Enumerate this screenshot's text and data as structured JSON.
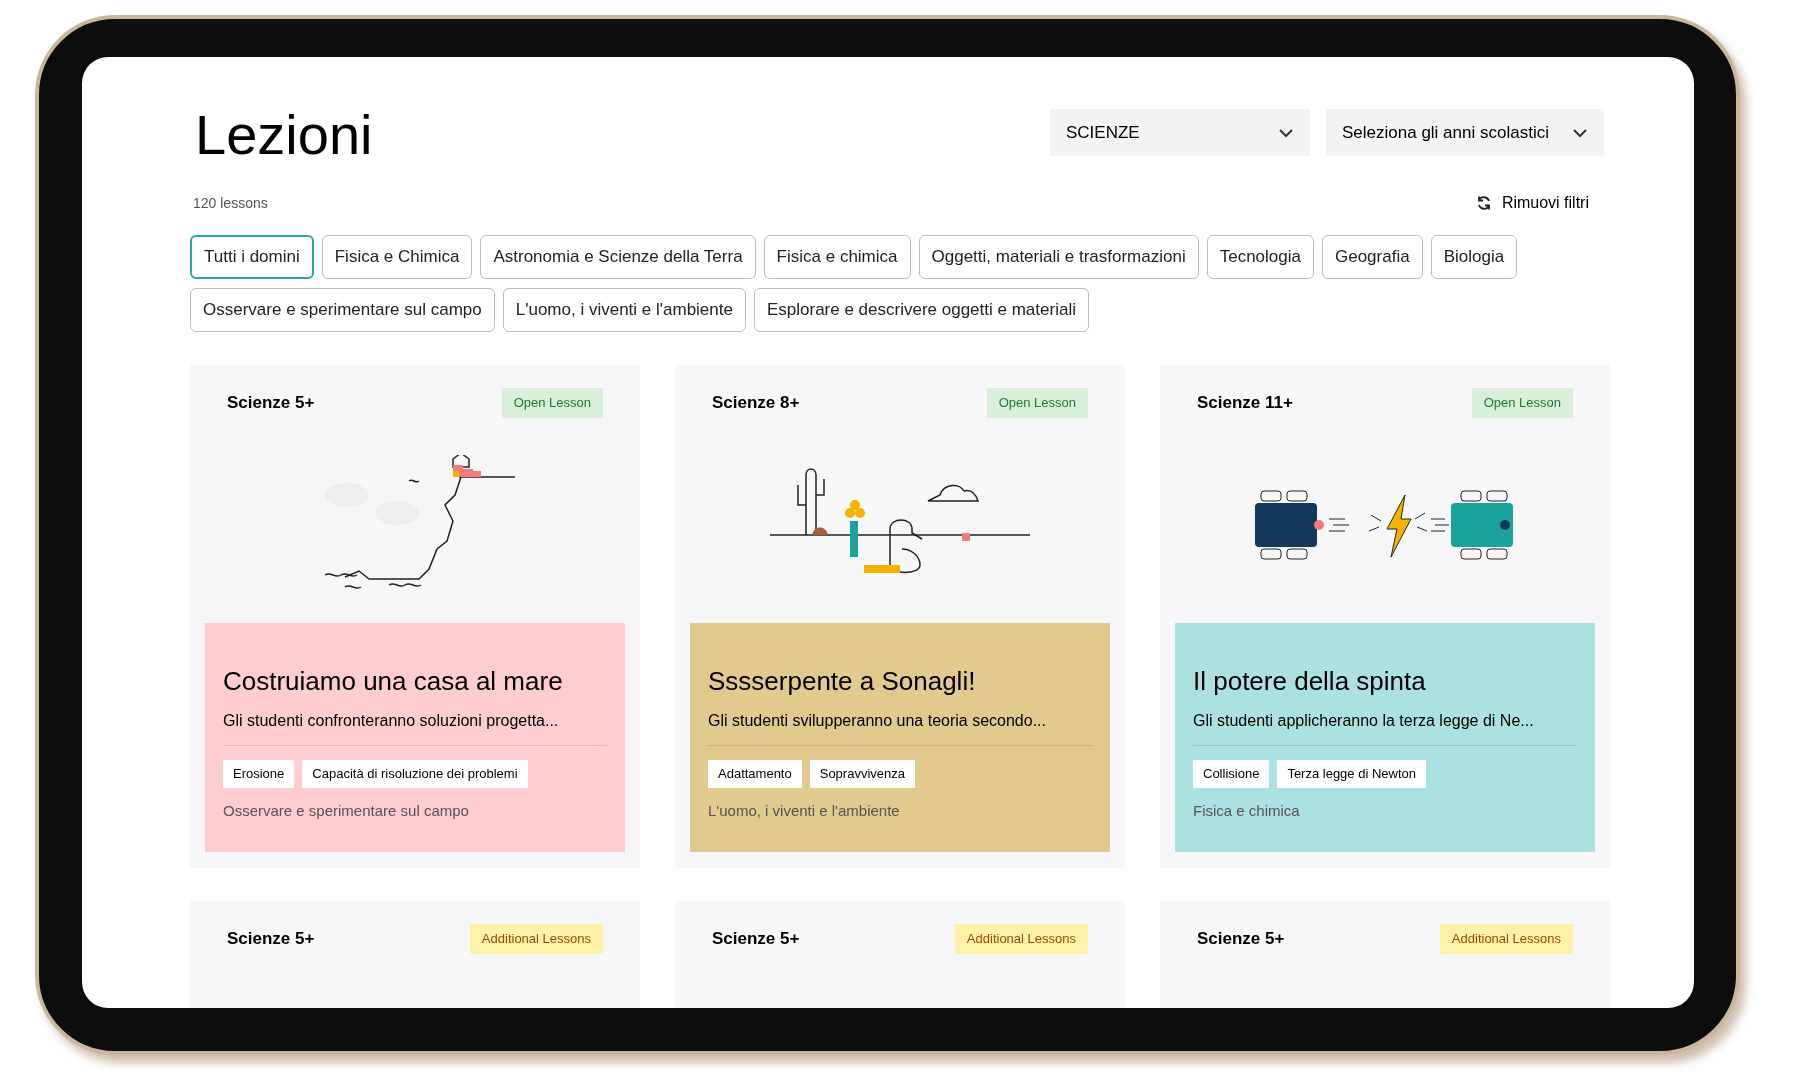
{
  "title": "Lezioni",
  "dropdowns": [
    {
      "label": "SCIENZE"
    },
    {
      "label": "Seleziona gli anni scolastici"
    }
  ],
  "count": "120 lessons",
  "reset": "Rimuovi filtri",
  "chips": [
    {
      "label": "Tutti i domini",
      "selected": true
    },
    {
      "label": "Fisica e Chimica",
      "selected": false
    },
    {
      "label": "Astronomia e Scienze della Terra",
      "selected": false
    },
    {
      "label": "Fisica e chimica",
      "selected": false
    },
    {
      "label": "Oggetti, materiali e trasformazioni",
      "selected": false
    },
    {
      "label": "Tecnologia",
      "selected": false
    },
    {
      "label": "Geografia",
      "selected": false
    },
    {
      "label": "Biologia",
      "selected": false
    },
    {
      "label": "Osservare e sperimentare sul campo",
      "selected": false
    },
    {
      "label": "L'uomo, i viventi e l'ambiente",
      "selected": false
    },
    {
      "label": "Esplorare e descrivere oggetti e materiali",
      "selected": false
    }
  ],
  "cards": [
    {
      "level_label": "Scienze 5+",
      "badge": {
        "kind": "open",
        "label": "Open Lesson"
      },
      "kind": "cliff",
      "color": "#fecdd0",
      "title": "Costruiamo una casa al mare",
      "description": "Gli studenti confronteranno soluzioni progetta...",
      "tags": [
        "Erosione",
        "Capacità di risoluzione dei problemi"
      ],
      "domain": "Osservare e sperimentare sul campo"
    },
    {
      "level_label": "Scienze 8+",
      "badge": {
        "kind": "open",
        "label": "Open Lesson"
      },
      "kind": "desert",
      "color": "#e2ca8f",
      "title": "Sssserpente a Sonagli!",
      "description": "Gli studenti svilupperanno una teoria secondo...",
      "tags": [
        "Adattamento",
        "Sopravvivenza"
      ],
      "domain": "L'uomo, i viventi e l'ambiente"
    },
    {
      "level_label": "Scienze 11+",
      "badge": {
        "kind": "open",
        "label": "Open Lesson"
      },
      "kind": "cars",
      "color": "#abe1e1",
      "title": "Il potere della spinta",
      "description": "Gli studenti applicheranno la terza legge di Ne...",
      "tags": [
        "Collisione",
        "Terza legge di Newton"
      ],
      "domain": "Fisica e chimica"
    },
    {
      "level_label": "Scienze 5+",
      "badge": {
        "kind": "additional",
        "label": "Additional Lessons"
      }
    },
    {
      "level_label": "Scienze 5+",
      "badge": {
        "kind": "additional",
        "label": "Additional Lessons"
      }
    },
    {
      "level_label": "Scienze 5+",
      "badge": {
        "kind": "additional",
        "label": "Additional Lessons"
      }
    }
  ]
}
